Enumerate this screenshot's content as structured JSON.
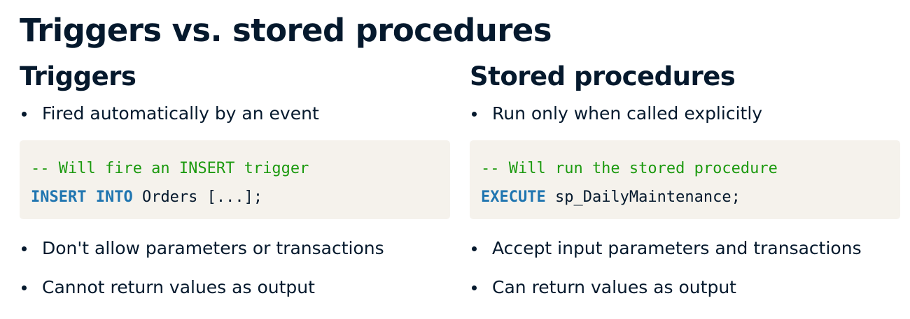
{
  "title": "Triggers vs. stored procedures",
  "left": {
    "heading": "Triggers",
    "bullet_top": "Fired automatically by an event",
    "code": {
      "comment": "-- Will fire an INSERT trigger",
      "keyword": "INSERT INTO",
      "rest": " Orders [...];"
    },
    "bullets_bottom": [
      "Don't allow parameters or transactions",
      "Cannot return values as output"
    ]
  },
  "right": {
    "heading": "Stored procedures",
    "bullet_top": "Run only when called explicitly",
    "code": {
      "comment": "-- Will run the stored procedure",
      "keyword": "EXECUTE",
      "rest": " sp_DailyMaintenance;"
    },
    "bullets_bottom": [
      "Accept input parameters and transactions",
      "Can return values as output"
    ]
  },
  "colors": {
    "text": "#05192d",
    "code_background": "#f5f2ec",
    "code_comment": "#1c9a0f",
    "code_keyword": "#1f75b0"
  }
}
